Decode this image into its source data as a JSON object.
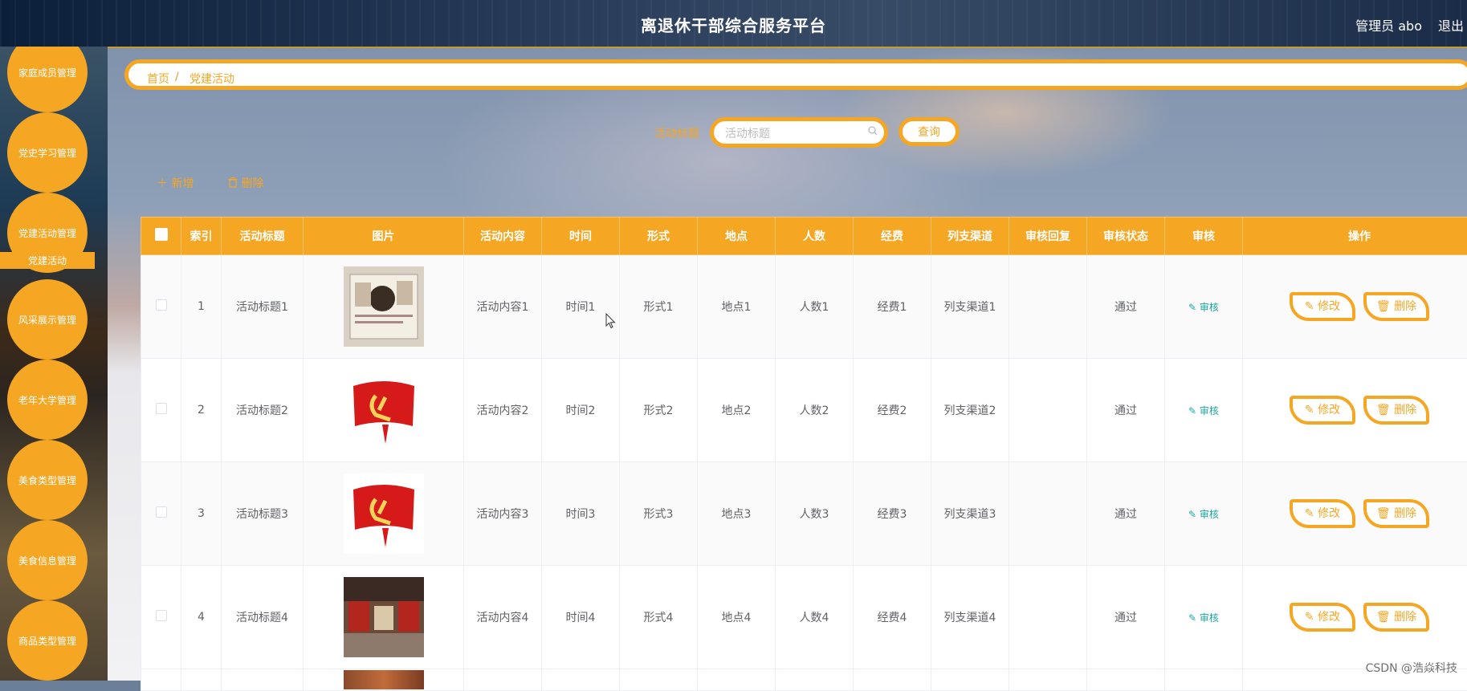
{
  "header": {
    "title": "离退休干部综合服务平台",
    "user": "管理员 abo",
    "logout": "退出"
  },
  "sidebar": {
    "items": [
      {
        "label": "家庭成员管理"
      },
      {
        "label": "党史学习管理"
      },
      {
        "label": "党建活动管理"
      },
      {
        "label": "风采展示管理"
      },
      {
        "label": "老年大学管理"
      },
      {
        "label": "美食类型管理"
      },
      {
        "label": "美食信息管理"
      },
      {
        "label": "商品类型管理"
      }
    ],
    "active_sub": "党建活动"
  },
  "breadcrumb": {
    "home": "首页",
    "separator": "/",
    "current": "党建活动"
  },
  "search": {
    "label": "活动标题",
    "placeholder": "活动标题",
    "value": "",
    "button": "查询"
  },
  "actions": {
    "add": "新增",
    "delete": "删除"
  },
  "table": {
    "headers": [
      "索引",
      "活动标题",
      "图片",
      "活动内容",
      "时间",
      "形式",
      "地点",
      "人数",
      "经费",
      "列支渠道",
      "审核回复",
      "审核状态",
      "审核",
      "操作"
    ],
    "rows": [
      {
        "index": "1",
        "title": "活动标题1",
        "image": "plaque",
        "content": "活动内容1",
        "time": "时间1",
        "form": "形式1",
        "place": "地点1",
        "count": "人数1",
        "funds": "经费1",
        "channel": "列支渠道1",
        "reply": "",
        "status": "通过",
        "review": "审核",
        "edit": "修改",
        "del": "删除"
      },
      {
        "index": "2",
        "title": "活动标题2",
        "image": "party-flag",
        "content": "活动内容2",
        "time": "时间2",
        "form": "形式2",
        "place": "地点2",
        "count": "人数2",
        "funds": "经费2",
        "channel": "列支渠道2",
        "reply": "",
        "status": "通过",
        "review": "审核",
        "edit": "修改",
        "del": "删除"
      },
      {
        "index": "3",
        "title": "活动标题3",
        "image": "party-flag",
        "content": "活动内容3",
        "time": "时间3",
        "form": "形式3",
        "place": "地点3",
        "count": "人数3",
        "funds": "经费3",
        "channel": "列支渠道3",
        "reply": "",
        "status": "通过",
        "review": "审核",
        "edit": "修改",
        "del": "删除"
      },
      {
        "index": "4",
        "title": "活动标题4",
        "image": "exhibition-hall",
        "content": "活动内容4",
        "time": "时间4",
        "form": "形式4",
        "place": "地点4",
        "count": "人数4",
        "funds": "经费4",
        "channel": "列支渠道4",
        "reply": "",
        "status": "通过",
        "review": "审核",
        "edit": "修改",
        "del": "删除"
      }
    ]
  },
  "colors": {
    "accent": "#f5a623",
    "review": "#1aa79b"
  },
  "watermark": "CSDN @浩焱科技"
}
